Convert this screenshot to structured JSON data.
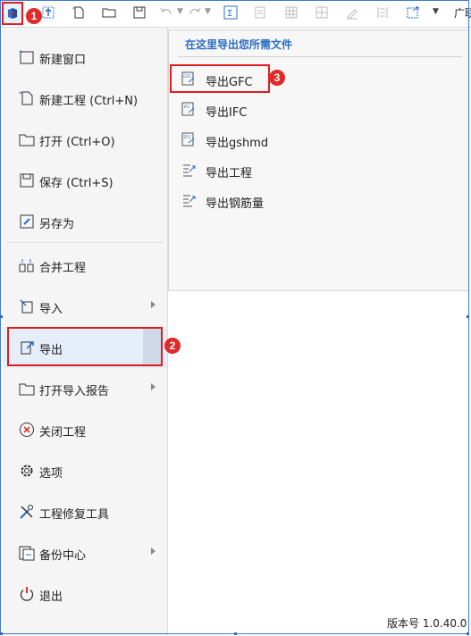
{
  "toolbar": {
    "trailing_text": "广联",
    "icons": [
      "app-logo-icon",
      "upload-icon",
      "new-file-icon",
      "open-folder-icon",
      "save-icon",
      "undo-icon",
      "redo-icon",
      "sum-icon",
      "report-icon",
      "table-icon",
      "edit-icon",
      "column-icon",
      "export-icon",
      "more-icon"
    ]
  },
  "badges": [
    "1",
    "2",
    "3"
  ],
  "menu": {
    "items": [
      {
        "label": "新建窗口",
        "icon": "new-window-icon"
      },
      {
        "label": "新建工程 (Ctrl+N)",
        "icon": "new-project-icon"
      },
      {
        "label": "打开 (Ctrl+O)",
        "icon": "open-folder-icon"
      },
      {
        "label": "保存 (Ctrl+S)",
        "icon": "save-icon"
      },
      {
        "label": "另存为",
        "icon": "save-as-icon"
      },
      {
        "label": "合并工程",
        "icon": "merge-icon"
      },
      {
        "label": "导入",
        "icon": "import-icon"
      },
      {
        "label": "导出",
        "icon": "export-icon"
      },
      {
        "label": "打开导入报告",
        "icon": "report-folder-icon"
      },
      {
        "label": "关闭工程",
        "icon": "close-circle-icon"
      },
      {
        "label": "选项",
        "icon": "gear-icon"
      },
      {
        "label": "工程修复工具",
        "icon": "repair-tools-icon"
      },
      {
        "label": "备份中心",
        "icon": "backup-icon"
      },
      {
        "label": "退出",
        "icon": "power-icon"
      }
    ]
  },
  "submenu": {
    "title": "在这里导出您所需文件",
    "items": [
      {
        "label": "导出GFC",
        "icon": "gfc-file-icon"
      },
      {
        "label": "导出IFC",
        "icon": "ifc-file-icon"
      },
      {
        "label": "导出gshmd",
        "icon": "zfc-file-icon"
      },
      {
        "label": "导出工程",
        "icon": "export-project-icon"
      },
      {
        "label": "导出钢筋量",
        "icon": "export-rebar-icon"
      }
    ]
  },
  "footer": {
    "version": "版本号 1.0.40.0"
  },
  "colors": {
    "accent": "#2a6cc5",
    "highlight": "#e01d1d",
    "menu_bg": "#f5f5f5"
  }
}
